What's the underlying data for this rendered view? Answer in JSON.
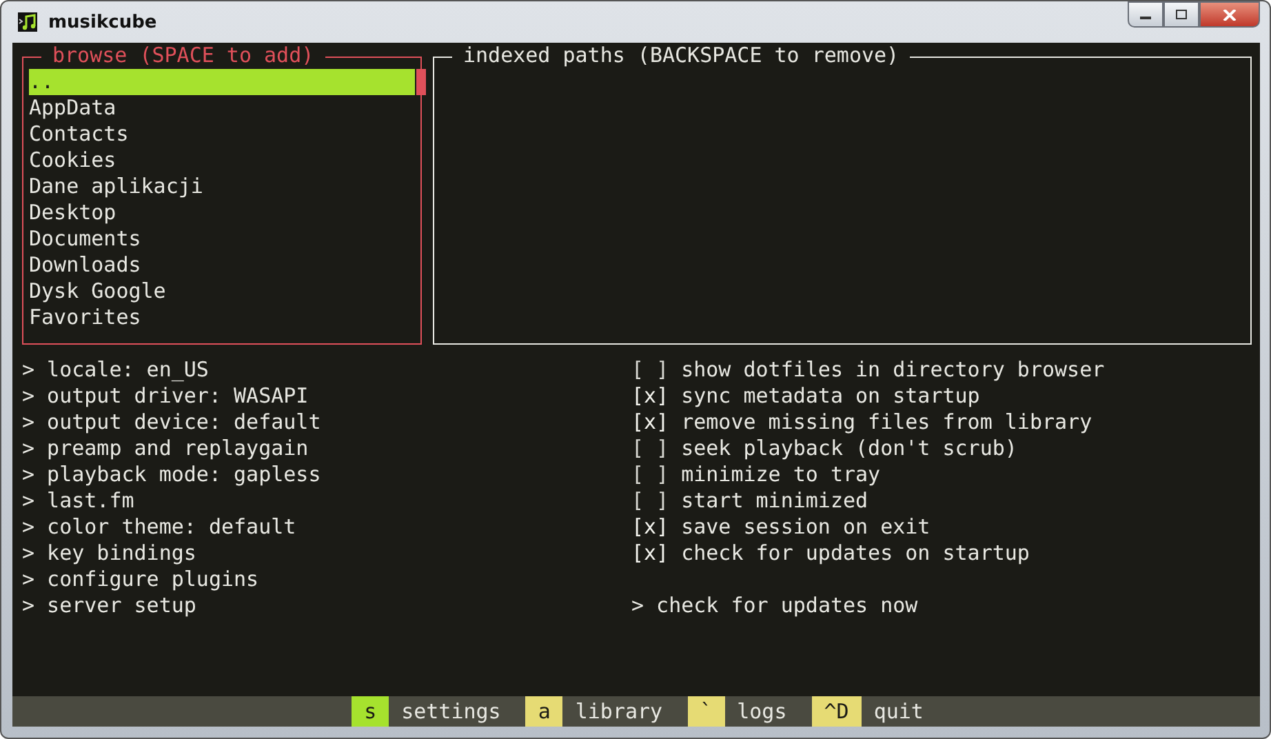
{
  "window": {
    "title": "musikcube"
  },
  "browse": {
    "title": "browse (SPACE to add)",
    "items": [
      {
        "label": "..",
        "selected": true
      },
      {
        "label": "AppData",
        "selected": false
      },
      {
        "label": "Contacts",
        "selected": false
      },
      {
        "label": "Cookies",
        "selected": false
      },
      {
        "label": "Dane aplikacji",
        "selected": false
      },
      {
        "label": "Desktop",
        "selected": false
      },
      {
        "label": "Documents",
        "selected": false
      },
      {
        "label": "Downloads",
        "selected": false
      },
      {
        "label": "Dysk Google",
        "selected": false
      },
      {
        "label": "Favorites",
        "selected": false
      }
    ]
  },
  "indexed_paths": {
    "title": "indexed paths (BACKSPACE to remove)"
  },
  "settings_left": [
    {
      "label": "> locale: en_US"
    },
    {
      "label": "> output driver: WASAPI"
    },
    {
      "label": "> output device: default"
    },
    {
      "label": "> preamp and replaygain"
    },
    {
      "label": "> playback mode: gapless"
    },
    {
      "label": "> last.fm"
    },
    {
      "label": "> color theme: default"
    },
    {
      "label": "> key bindings"
    },
    {
      "label": "> configure plugins"
    },
    {
      "label": "> server setup"
    }
  ],
  "settings_right": [
    {
      "kind": "checkbox",
      "box": "[ ]",
      "checked": false,
      "label": "show dotfiles in directory browser"
    },
    {
      "kind": "checkbox",
      "box": "[x]",
      "checked": true,
      "label": "sync metadata on startup"
    },
    {
      "kind": "checkbox",
      "box": "[x]",
      "checked": true,
      "label": "remove missing files from library"
    },
    {
      "kind": "checkbox",
      "box": "[ ]",
      "checked": false,
      "label": "seek playback (don't scrub)"
    },
    {
      "kind": "checkbox",
      "box": "[ ]",
      "checked": false,
      "label": "minimize to tray"
    },
    {
      "kind": "checkbox",
      "box": "[ ]",
      "checked": false,
      "label": "start minimized"
    },
    {
      "kind": "checkbox",
      "box": "[x]",
      "checked": true,
      "label": "save session on exit"
    },
    {
      "kind": "checkbox",
      "box": "[x]",
      "checked": true,
      "label": "check for updates on startup"
    },
    {
      "kind": "spacer"
    },
    {
      "kind": "action",
      "label": "> check for updates now"
    }
  ],
  "shortcuts": [
    {
      "key": "s",
      "label": "settings",
      "selected": true
    },
    {
      "key": "a",
      "label": "library",
      "selected": false
    },
    {
      "key": "`",
      "label": "logs",
      "selected": false
    },
    {
      "key": "^D",
      "label": "quit",
      "selected": false
    }
  ]
}
